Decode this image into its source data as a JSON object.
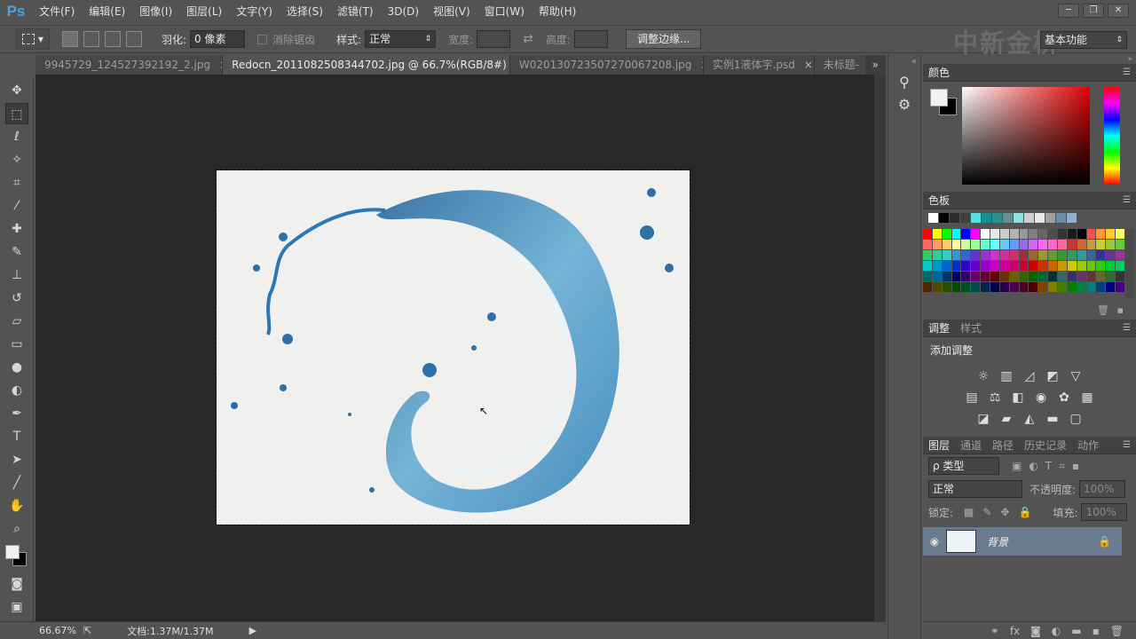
{
  "app": {
    "logo": "Ps"
  },
  "menu": [
    "文件(F)",
    "编辑(E)",
    "图像(I)",
    "图层(L)",
    "文字(Y)",
    "选择(S)",
    "滤镜(T)",
    "3D(D)",
    "视图(V)",
    "窗口(W)",
    "帮助(H)"
  ],
  "window_controls": {
    "min": "─",
    "restore": "❐",
    "close": "✕"
  },
  "options": {
    "feather_label": "羽化:",
    "feather_value": "0 像素",
    "antialias_label": "消除锯齿",
    "style_label": "样式:",
    "style_value": "正常",
    "width_label": "宽度:",
    "height_label": "高度:",
    "refine_button": "调整边缘...",
    "workspace": "基本功能",
    "watermark": "中新金桥"
  },
  "tabs": [
    {
      "label": "9945729_124527392192_2.jpg",
      "active": false
    },
    {
      "label": "Redocn_2011082508344702.jpg @ 66.7%(RGB/8#)",
      "active": true
    },
    {
      "label": "W020130723507270067208.jpg",
      "active": false
    },
    {
      "label": "实例1液体字.psd",
      "active": false
    },
    {
      "label": "未标题-",
      "active": false
    }
  ],
  "status": {
    "zoom": "66.67%",
    "doc_info": "文档:1.37M/1.37M"
  },
  "panels": {
    "color_tab": "颜色",
    "swatches_tab": "色板",
    "adjust_tab": "调整",
    "styles_tab": "样式",
    "add_adjustment": "添加调整",
    "layers_tab": "图层",
    "channels_tab": "通道",
    "paths_tab": "路径",
    "history_tab": "历史记录",
    "actions_tab": "动作",
    "kind_label": "ρ 类型",
    "blend_mode": "正常",
    "opacity_label": "不透明度:",
    "opacity_value": "100%",
    "lock_label": "锁定:",
    "fill_label": "填充:",
    "fill_value": "100%",
    "layer_name": "背景"
  },
  "colors": {
    "swatch_top": [
      "#ffffff",
      "#000000",
      "#2b2b2b",
      "#404040",
      "#59e0e0",
      "#1a8f8f",
      "#2e8f8f",
      "#6a8f8f",
      "#8fe0e0",
      "#cfcfcf",
      "#e8e8e8",
      "#a0a0a0",
      "#6e8aa0",
      "#8fb0c8"
    ],
    "swatch_rows": [
      [
        "#ff0000",
        "#ffff00",
        "#00ff00",
        "#00ffff",
        "#0000ff",
        "#ff00ff",
        "#ffffff",
        "#e6e6e6",
        "#cccccc",
        "#b3b3b3",
        "#999999",
        "#808080",
        "#666666",
        "#4d4d4d",
        "#333333",
        "#1a1a1a",
        "#000000",
        "#ff4d4d",
        "#ff9933",
        "#ffcc33",
        "#ffff66"
      ],
      [
        "#ff6666",
        "#ff9966",
        "#ffcc66",
        "#ffff99",
        "#ccff99",
        "#99ff99",
        "#66ffcc",
        "#66ffff",
        "#66ccff",
        "#6699ff",
        "#9966ff",
        "#cc66ff",
        "#ff66ff",
        "#ff66cc",
        "#ff6699",
        "#cc3333",
        "#cc6633",
        "#cc9933",
        "#cccc33",
        "#99cc33",
        "#66cc33"
      ],
      [
        "#33cc66",
        "#33cc99",
        "#33cccc",
        "#3399cc",
        "#3366cc",
        "#6633cc",
        "#9933cc",
        "#cc33cc",
        "#cc3399",
        "#cc3366",
        "#993333",
        "#996633",
        "#999933",
        "#669933",
        "#339933",
        "#339966",
        "#339999",
        "#336699",
        "#333399",
        "#663399",
        "#993399"
      ],
      [
        "#00cccc",
        "#0099cc",
        "#0066cc",
        "#0033cc",
        "#3300cc",
        "#6600cc",
        "#9900cc",
        "#cc00cc",
        "#cc0099",
        "#cc0066",
        "#cc0033",
        "#cc0000",
        "#cc3300",
        "#cc6600",
        "#cc9900",
        "#cccc00",
        "#99cc00",
        "#66cc00",
        "#33cc00",
        "#00cc33",
        "#00cc66"
      ],
      [
        "#006666",
        "#006699",
        "#003366",
        "#000066",
        "#330066",
        "#660066",
        "#660033",
        "#660000",
        "#663300",
        "#666600",
        "#336600",
        "#006600",
        "#006633",
        "#003333",
        "#336666",
        "#333366",
        "#663366",
        "#663333",
        "#666633",
        "#336633",
        "#333333"
      ],
      [
        "#4d2600",
        "#4d4d00",
        "#264d00",
        "#004d00",
        "#004d26",
        "#004d4d",
        "#00264d",
        "#00004d",
        "#26004d",
        "#4d004d",
        "#4d0026",
        "#4d0000",
        "#804000",
        "#808000",
        "#408000",
        "#008000",
        "#008040",
        "#008080",
        "#004080",
        "#000080",
        "#400080"
      ]
    ]
  }
}
